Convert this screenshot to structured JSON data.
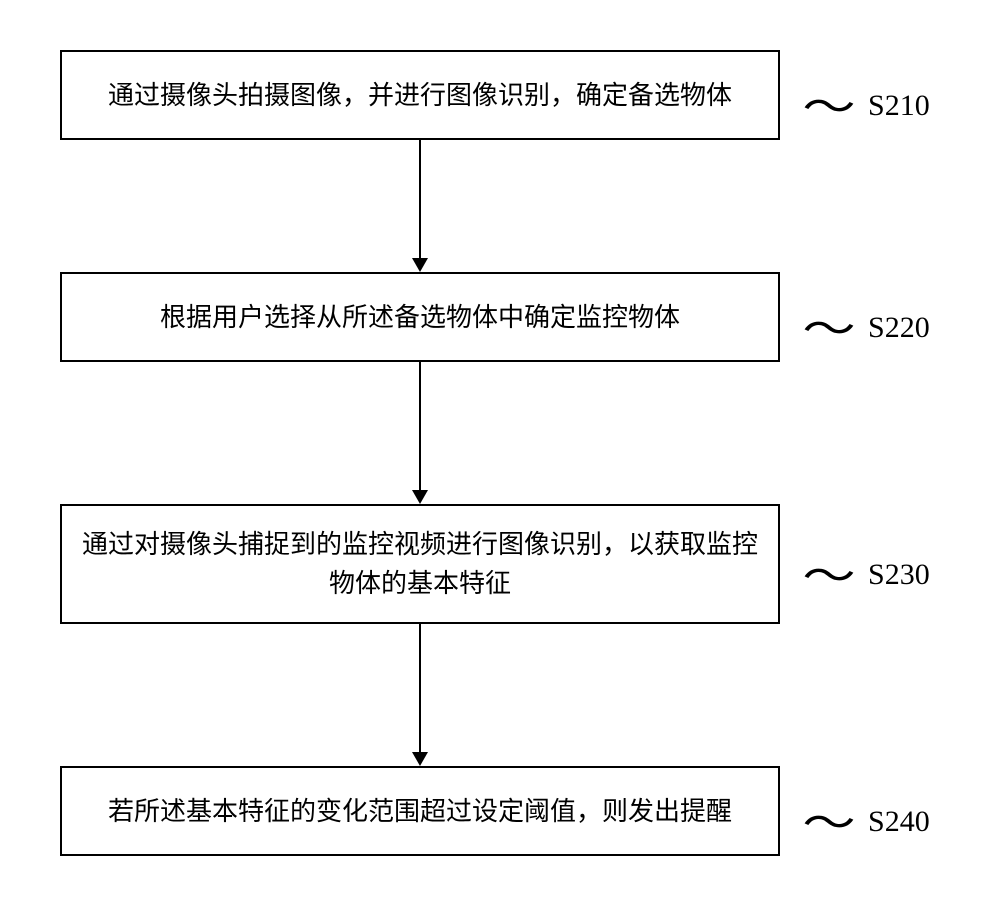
{
  "steps": [
    {
      "text": "通过摄像头拍摄图像，并进行图像识别，确定备选物体",
      "label": "S210"
    },
    {
      "text": "根据用户选择从所述备选物体中确定监控物体",
      "label": "S220"
    },
    {
      "text": "通过对摄像头捕捉到的监控视频进行图像识别，以获取监控物体的基本特征",
      "label": "S230"
    },
    {
      "text": "若所述基本特征的变化范围超过设定阈值，则发出提醒",
      "label": "S240"
    }
  ]
}
